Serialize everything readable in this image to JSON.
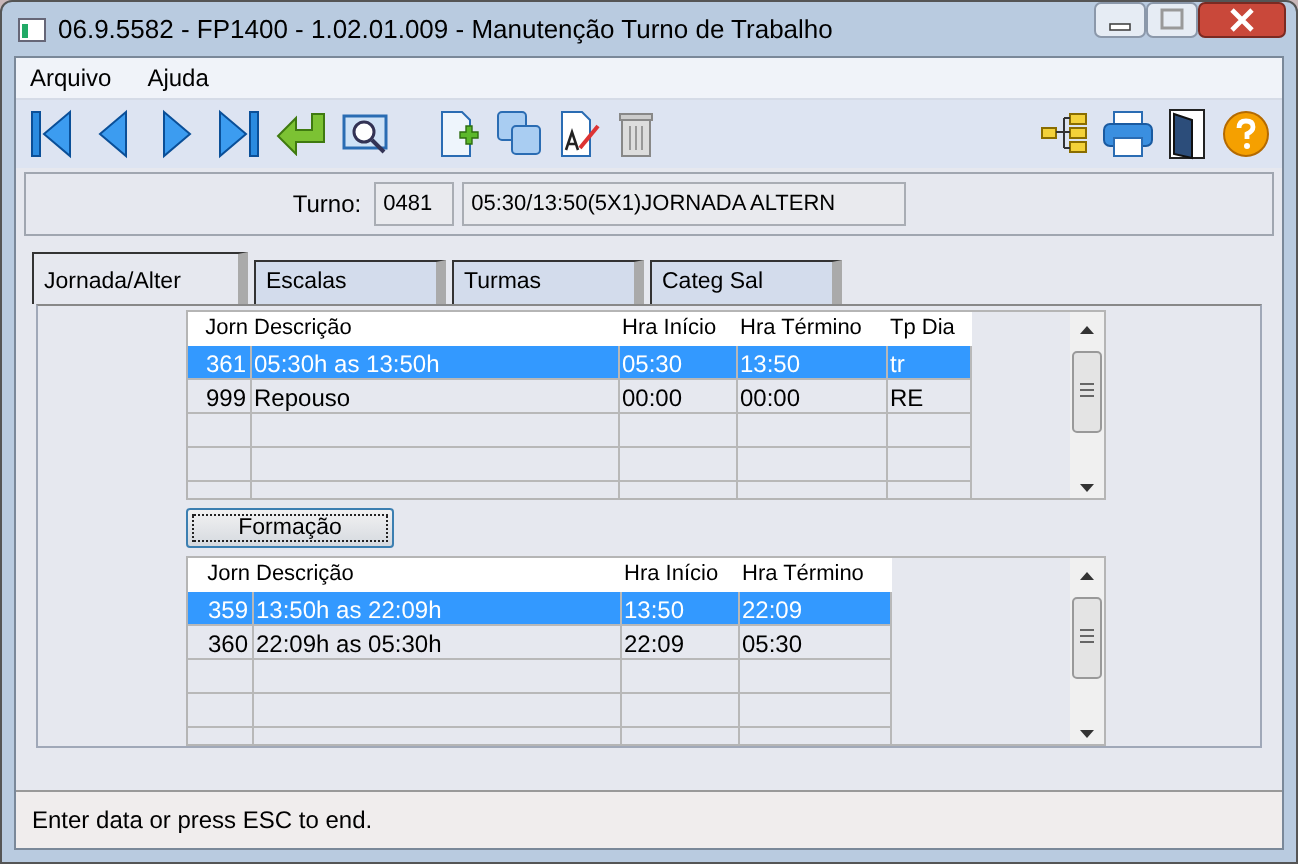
{
  "window": {
    "title": "06.9.5582 - FP1400 - 1.02.01.009 - Manutenção Turno de Trabalho"
  },
  "menu": [
    "Arquivo",
    "Ajuda"
  ],
  "turno": {
    "label": "Turno:",
    "code": "0481",
    "description": "05:30/13:50(5X1)JORNADA ALTERN"
  },
  "tabs": [
    {
      "label": "Jornada/Alter",
      "selected": true
    },
    {
      "label": "Escalas",
      "selected": false
    },
    {
      "label": "Turmas",
      "selected": false
    },
    {
      "label": "Categ Sal",
      "selected": false
    }
  ],
  "jornadas": {
    "columns": [
      "Jorn",
      "Descrição",
      "Hra Início",
      "Hra Término",
      "Tp Dia"
    ],
    "rows": [
      {
        "cells": [
          "361",
          "05:30h as 13:50h",
          "05:30",
          "13:50",
          "tr"
        ],
        "selected": true
      },
      {
        "cells": [
          "999",
          "Repouso",
          "00:00",
          "00:00",
          "RE"
        ],
        "selected": false
      }
    ]
  },
  "formacao_button": "Formação",
  "formacao": {
    "columns": [
      "Jorn",
      "Descrição",
      "Hra Início",
      "Hra Término"
    ],
    "rows": [
      {
        "cells": [
          "359",
          "13:50h as 22:09h",
          "13:50",
          "22:09"
        ],
        "selected": true
      },
      {
        "cells": [
          "360",
          "22:09h as 05:30h",
          "22:09",
          "05:30"
        ],
        "selected": false
      }
    ]
  },
  "status_bar": "Enter data or press ESC to end."
}
